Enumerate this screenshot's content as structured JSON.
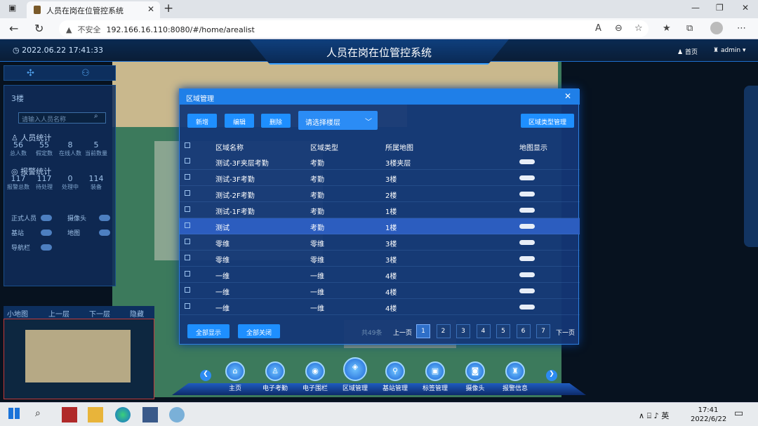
{
  "browser": {
    "tab_title": "人员在岗在位管控系统",
    "security_label": "不安全",
    "url": "192.166.16.110:8080/#/home/arealist"
  },
  "header": {
    "datetime": "2022.06.22 17:41:33",
    "title": "人员在岗在位管控系统",
    "home_label": "首页",
    "user_label": "admin"
  },
  "left_panel": {
    "floor": "3楼",
    "search_placeholder": "请输入人员名称",
    "person_title": "人员统计",
    "person_stats": [
      {
        "value": "56",
        "label": "总人数"
      },
      {
        "value": "55",
        "label": "假定数"
      },
      {
        "value": "8",
        "label": "在线人数"
      },
      {
        "value": "5",
        "label": "当前数量"
      }
    ],
    "alarm_title": "报警统计",
    "alarm_stats": [
      {
        "value": "117",
        "label": "报警总数"
      },
      {
        "value": "117",
        "label": "待处理"
      },
      {
        "value": "0",
        "label": "处理中"
      },
      {
        "value": "114",
        "label": "装备"
      }
    ],
    "toggles": [
      "正式人员",
      "摄像头",
      "基站",
      "地图",
      "导航栏"
    ]
  },
  "minimap": {
    "labels": [
      "小地图",
      "上一层",
      "下一层",
      "隐藏"
    ]
  },
  "dialog": {
    "title": "区域管理",
    "buttons": {
      "add": "新增",
      "edit": "编辑",
      "delete": "删除",
      "type_manage": "区域类型管理"
    },
    "floor_select_placeholder": "请选择楼层",
    "columns": [
      "区域名称",
      "区域类型",
      "所属地图",
      "地图显示"
    ],
    "rows": [
      [
        "测试-3F夹层考勤",
        "考勤",
        "3楼夹层"
      ],
      [
        "测试-3F考勤",
        "考勤",
        "3楼"
      ],
      [
        "测试-2F考勤",
        "考勤",
        "2楼"
      ],
      [
        "测试-1F考勤",
        "考勤",
        "1楼"
      ],
      [
        "测试",
        "考勤",
        "1楼"
      ],
      [
        "零维",
        "零维",
        "3楼"
      ],
      [
        "零维",
        "零维",
        "3楼"
      ],
      [
        "一维",
        "一维",
        "4楼"
      ],
      [
        "一维",
        "一维",
        "4楼"
      ],
      [
        "一维",
        "一维",
        "4楼"
      ]
    ],
    "selected_row": 4,
    "show_all": "全部显示",
    "close_all": "全部关闭",
    "total": "共49条",
    "prev": "上一页",
    "next": "下一页",
    "pages": [
      "1",
      "2",
      "3",
      "4",
      "5",
      "6",
      "7"
    ],
    "current_page": "1"
  },
  "toolbar": {
    "items": [
      {
        "label": "主页",
        "icon": "home-icon"
      },
      {
        "label": "电子考勤",
        "icon": "user-check-icon"
      },
      {
        "label": "电子围栏",
        "icon": "fence-icon"
      },
      {
        "label": "区域管理",
        "icon": "layers-icon"
      },
      {
        "label": "基站管理",
        "icon": "antenna-icon"
      },
      {
        "label": "标签管理",
        "icon": "tag-icon"
      },
      {
        "label": "摄像头",
        "icon": "camera-icon"
      },
      {
        "label": "报警信息",
        "icon": "alarm-icon"
      }
    ]
  },
  "taskbar": {
    "time": "17:41",
    "date": "2022/6/22",
    "ime": "英"
  }
}
